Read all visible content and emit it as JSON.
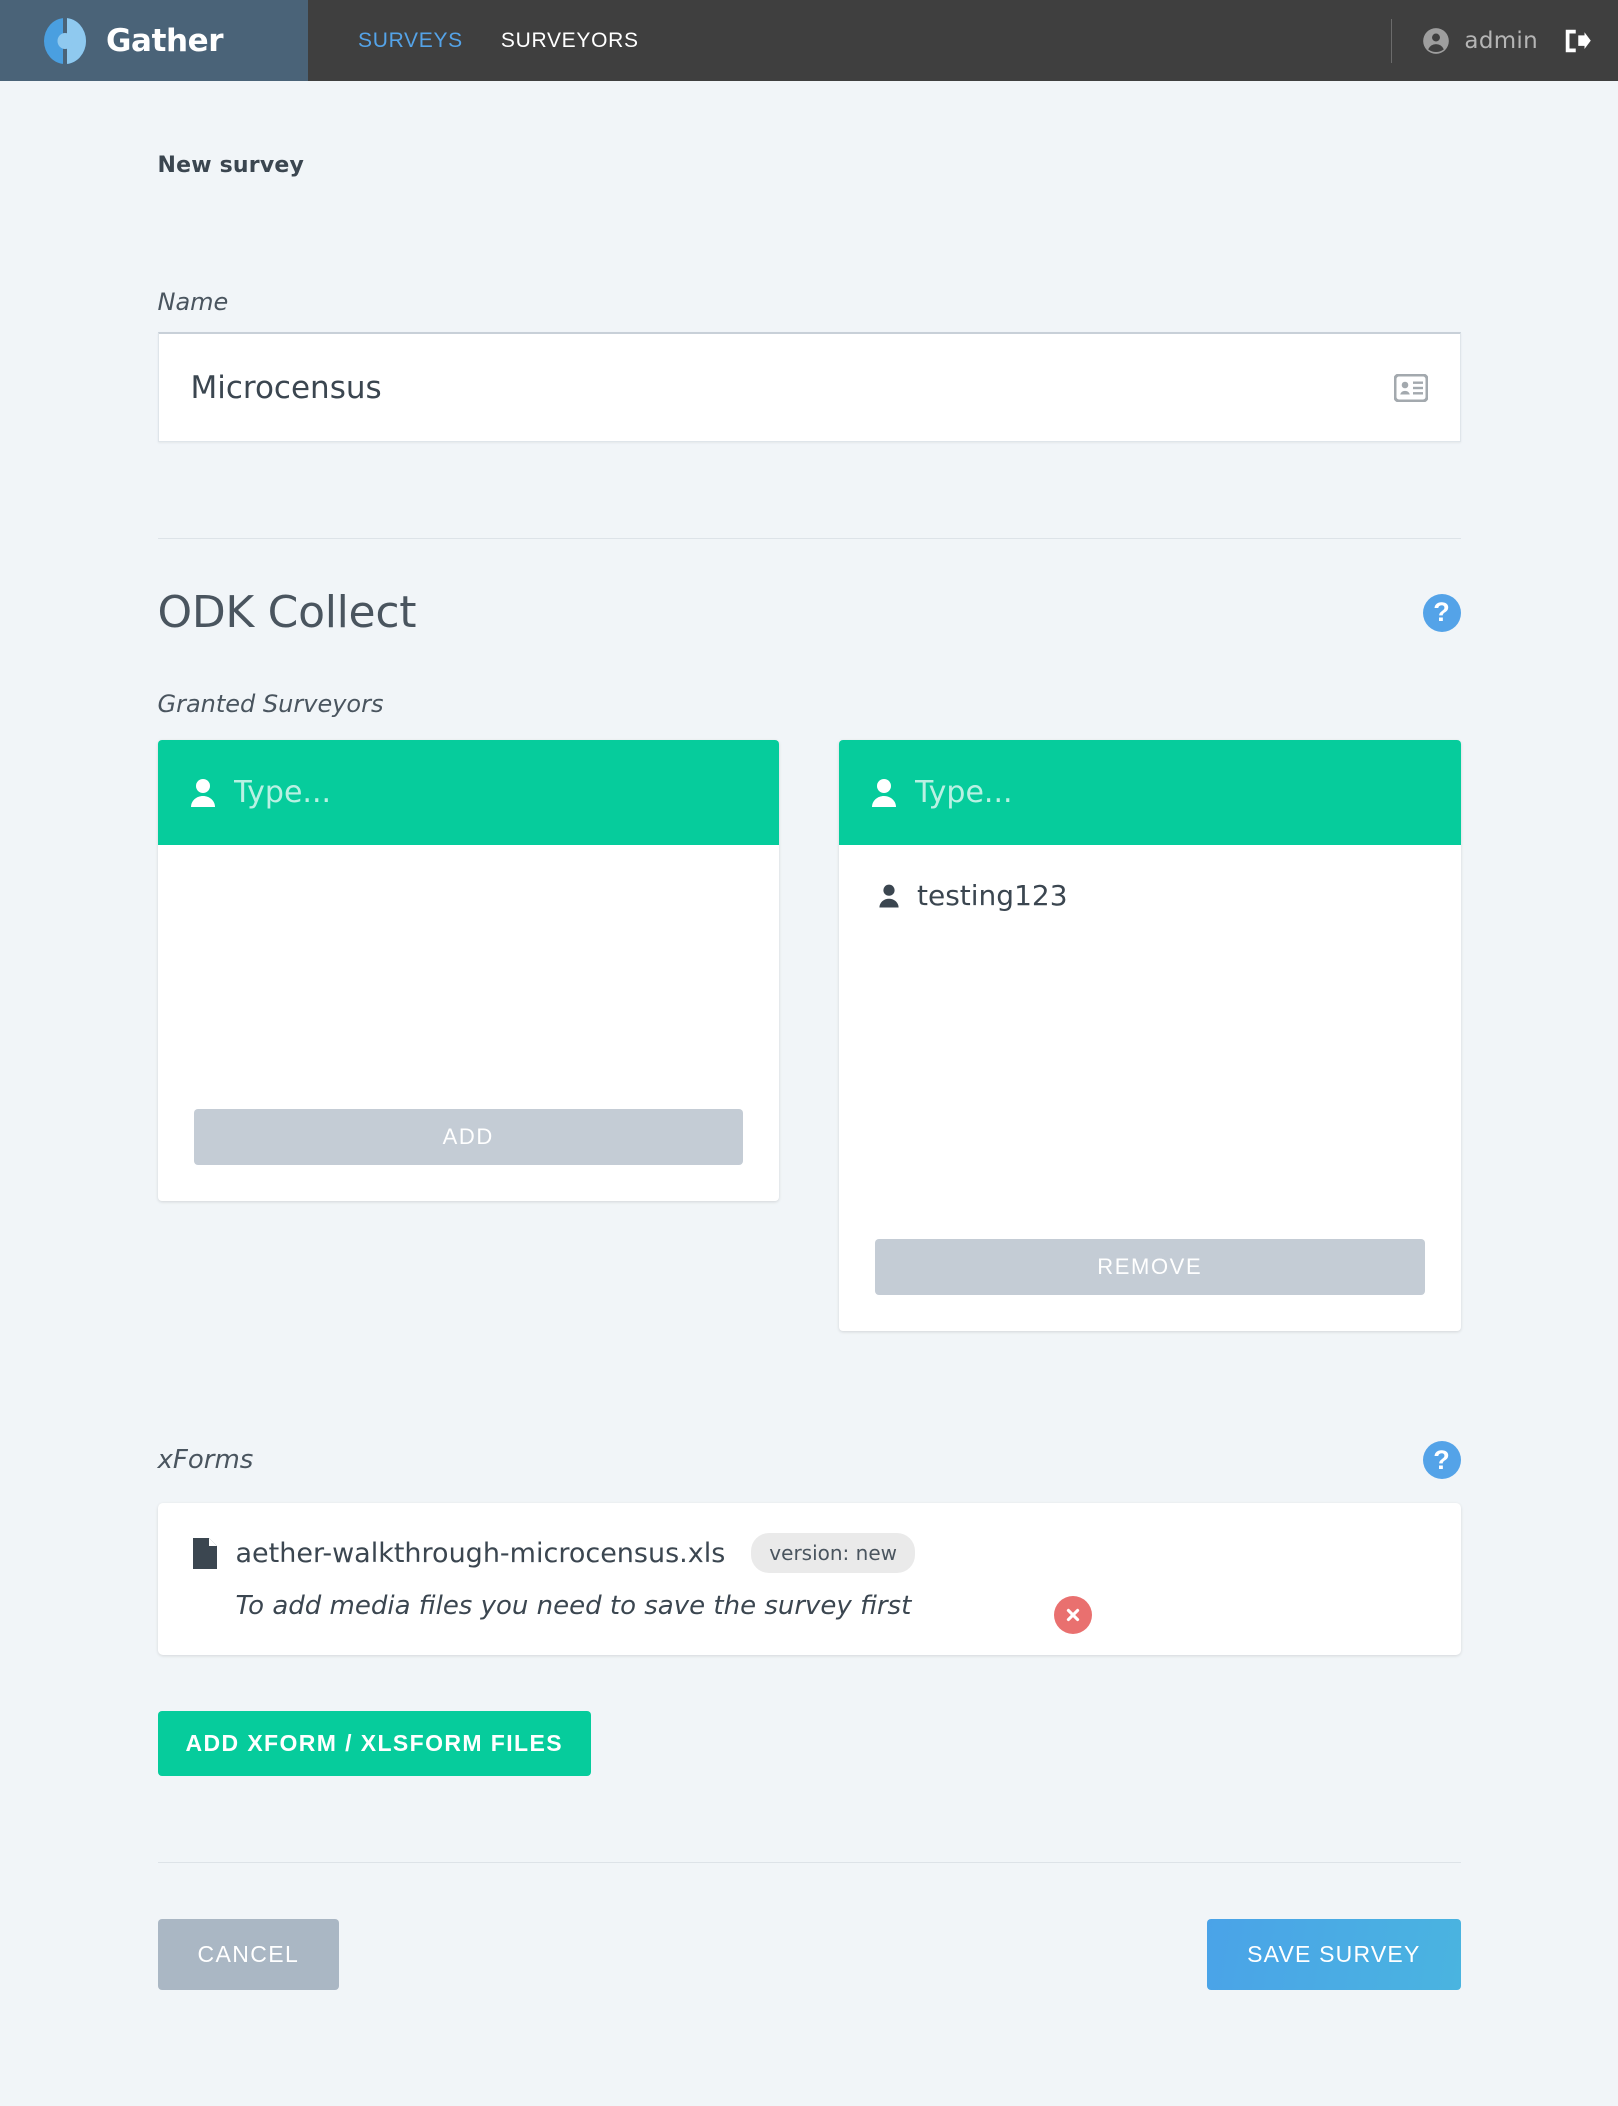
{
  "navbar": {
    "brand": "Gather",
    "brand_logo_icon": "gather-logo-icon",
    "links": [
      {
        "label": "SURVEYS",
        "active": true
      },
      {
        "label": "SURVEYORS",
        "active": false
      }
    ],
    "user": {
      "name": "admin",
      "user_icon": "account-circle-icon",
      "logout_icon": "logout-icon"
    }
  },
  "page": {
    "title": "New survey"
  },
  "name_field": {
    "label": "Name",
    "value": "Microcensus",
    "placeholder": "",
    "trailing_icon": "contact-card-icon"
  },
  "odk": {
    "title": "ODK Collect",
    "help_icon": "help-question-icon",
    "help_label": "?",
    "granted_label": "Granted Surveyors",
    "available_panel": {
      "search_placeholder": "Type...",
      "search_value": "",
      "head_icon": "person-icon",
      "items": [],
      "button_label": "ADD"
    },
    "granted_panel": {
      "search_placeholder": "Type...",
      "search_value": "",
      "head_icon": "person-icon",
      "items": [
        {
          "name": "testing123",
          "icon": "person-icon"
        }
      ],
      "button_label": "REMOVE"
    }
  },
  "xforms": {
    "label": "xForms",
    "help_icon": "help-question-icon",
    "help_label": "?",
    "files": [
      {
        "file_icon": "file-icon",
        "filename": "aether-walkthrough-microcensus.xls",
        "version_badge": "version: new",
        "note": "To add media files you need to save the survey first",
        "delete_icon": "close-circle-icon"
      }
    ],
    "add_button_label": "ADD XFORM / XLSFORM FILES"
  },
  "actions": {
    "cancel_label": "CANCEL",
    "save_label": "SAVE SURVEY"
  },
  "colors": {
    "brand_blue": "#4a6378",
    "nav_dark": "#3f3f3f",
    "accent_blue": "#54a3e8",
    "green": "#06cc9c",
    "grey_button": "#c4ccd5",
    "cancel_grey": "#aab7c4",
    "danger_red": "#e9706f",
    "page_bg": "#f1f5f8"
  }
}
